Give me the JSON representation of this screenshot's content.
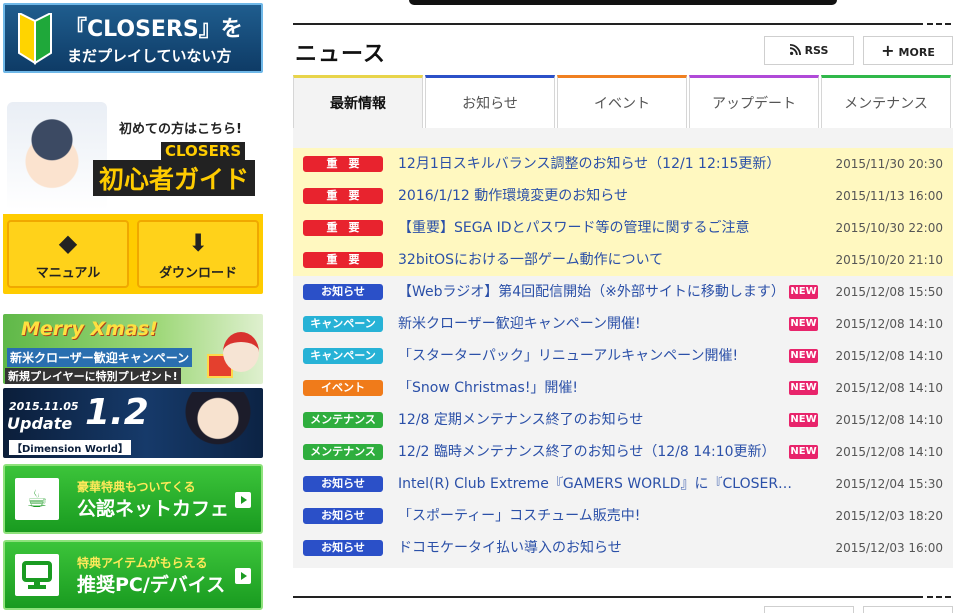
{
  "left_banners": {
    "beginner": {
      "line1": "『CLOSERS』を",
      "line2": "まだプレイしていない方"
    },
    "guide": {
      "text1": "初めての方はこちら!",
      "text2": "CLOSERS",
      "text3": "初心者ガイド",
      "manual_label": "マニュアル",
      "download_label": "ダウンロード"
    },
    "xmas": {
      "title": "Merry Xmas!",
      "sub": "新米クローザー歓迎キャンペーン",
      "sub2": "新規プレイヤーに特別プレゼント!"
    },
    "update": {
      "date": "2015.11.05",
      "word": "Update",
      "num": "1.2",
      "world": "【Dimension World】"
    },
    "cafe": {
      "line1": "豪華特典もついてくる",
      "line2": "公認ネットカフェ"
    },
    "pc": {
      "line1": "特典アイテムがもらえる",
      "line2": "推奨PC/デバイス"
    }
  },
  "news": {
    "title": "ニュース",
    "rss_label": "RSS",
    "more_label": "MORE",
    "tabs": [
      {
        "label": "最新情報",
        "color": "#e8d44a"
      },
      {
        "label": "お知らせ",
        "color": "#2b50c8"
      },
      {
        "label": "イベント",
        "color": "#f08020"
      },
      {
        "label": "アップデート",
        "color": "#b04ad8"
      },
      {
        "label": "メンテナンス",
        "color": "#30b84a"
      }
    ],
    "new_label": "NEW",
    "items": [
      {
        "badge": "重　要",
        "badge_color": "#e8232e",
        "title": "12月1日スキルバランス調整のお知らせ（12/1 12:15更新）",
        "date": "2015/11/30 20:30",
        "highlight": true,
        "is_new": false
      },
      {
        "badge": "重　要",
        "badge_color": "#e8232e",
        "title": "2016/1/12 動作環境変更のお知らせ",
        "date": "2015/11/13 16:00",
        "highlight": true,
        "is_new": false
      },
      {
        "badge": "重　要",
        "badge_color": "#e8232e",
        "title": "【重要】SEGA IDとパスワード等の管理に関するご注意",
        "date": "2015/10/30 22:00",
        "highlight": true,
        "is_new": false
      },
      {
        "badge": "重　要",
        "badge_color": "#e8232e",
        "title": "32bitOSにおける一部ゲーム動作について",
        "date": "2015/10/20 21:10",
        "highlight": true,
        "is_new": false
      },
      {
        "badge": "お知らせ",
        "badge_color": "#2b50c8",
        "title": "【Webラジオ】第4回配信開始（※外部サイトに移動します）",
        "date": "2015/12/08 15:50",
        "highlight": false,
        "is_new": true
      },
      {
        "badge": "キャンペーン",
        "badge_color": "#27b2d6",
        "title": "新米クローザー歓迎キャンペーン開催!",
        "date": "2015/12/08 14:10",
        "highlight": false,
        "is_new": true
      },
      {
        "badge": "キャンペーン",
        "badge_color": "#27b2d6",
        "title": "「スターターパック」リニューアルキャンペーン開催!",
        "date": "2015/12/08 14:10",
        "highlight": false,
        "is_new": true
      },
      {
        "badge": "イベント",
        "badge_color": "#f07b1a",
        "title": "「Snow Christmas!」開催!",
        "date": "2015/12/08 14:10",
        "highlight": false,
        "is_new": true
      },
      {
        "badge": "メンテナンス",
        "badge_color": "#2fae3e",
        "title": "12/8 定期メンテナンス終了のお知らせ",
        "date": "2015/12/08 14:10",
        "highlight": false,
        "is_new": true
      },
      {
        "badge": "メンテナンス",
        "badge_color": "#2fae3e",
        "title": "12/2 臨時メンテナンス終了のお知らせ（12/8 14:10更新）",
        "date": "2015/12/08 14:10",
        "highlight": false,
        "is_new": true
      },
      {
        "badge": "お知らせ",
        "badge_color": "#2b50c8",
        "title": "Intel(R) Club Extreme『GAMERS WORLD』に『CLOSERS...",
        "date": "2015/12/04 15:30",
        "highlight": false,
        "is_new": false
      },
      {
        "badge": "お知らせ",
        "badge_color": "#2b50c8",
        "title": "「スポーティー」コスチューム販売中!",
        "date": "2015/12/03 18:20",
        "highlight": false,
        "is_new": false
      },
      {
        "badge": "お知らせ",
        "badge_color": "#2b50c8",
        "title": "ドコモケータイ払い導入のお知らせ",
        "date": "2015/12/03 16:00",
        "highlight": false,
        "is_new": false
      }
    ]
  }
}
